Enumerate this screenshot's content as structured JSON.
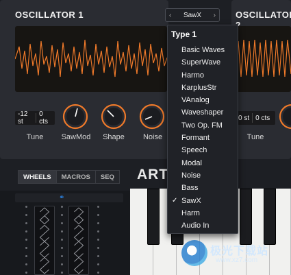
{
  "osc1": {
    "title": "OSCILLATOR 1",
    "coarse": "-12 st",
    "fine": "0 cts",
    "labels": [
      "Tune",
      "SawMod",
      "Shape",
      "Noise"
    ]
  },
  "osc2": {
    "title": "OSCILLATOR 2",
    "coarse": "0 st",
    "fine": "0 cts",
    "labels": [
      "Tune"
    ]
  },
  "selector": {
    "value": "SawX",
    "prev": "‹",
    "next": "›"
  },
  "dropdown": {
    "group": "Type 1",
    "items": [
      "Basic Waves",
      "SuperWave",
      "Harmo",
      "KarplusStr",
      "VAnalog",
      "Waveshaper",
      "Two Op. FM",
      "Formant",
      "Speech",
      "Modal",
      "Noise",
      "Bass",
      "SawX",
      "Harm",
      "Audio In"
    ],
    "selected": "SawX",
    "check": "✓"
  },
  "tabs": [
    "WHEELS",
    "MACROS",
    "SEQ"
  ],
  "brand": "ART",
  "watermark": {
    "text": "极光下载站",
    "url": "www.xz7.com"
  },
  "colors": {
    "accent": "#f07a2a",
    "waveform": "#f07a2a",
    "selected_check": "#ffffff"
  }
}
